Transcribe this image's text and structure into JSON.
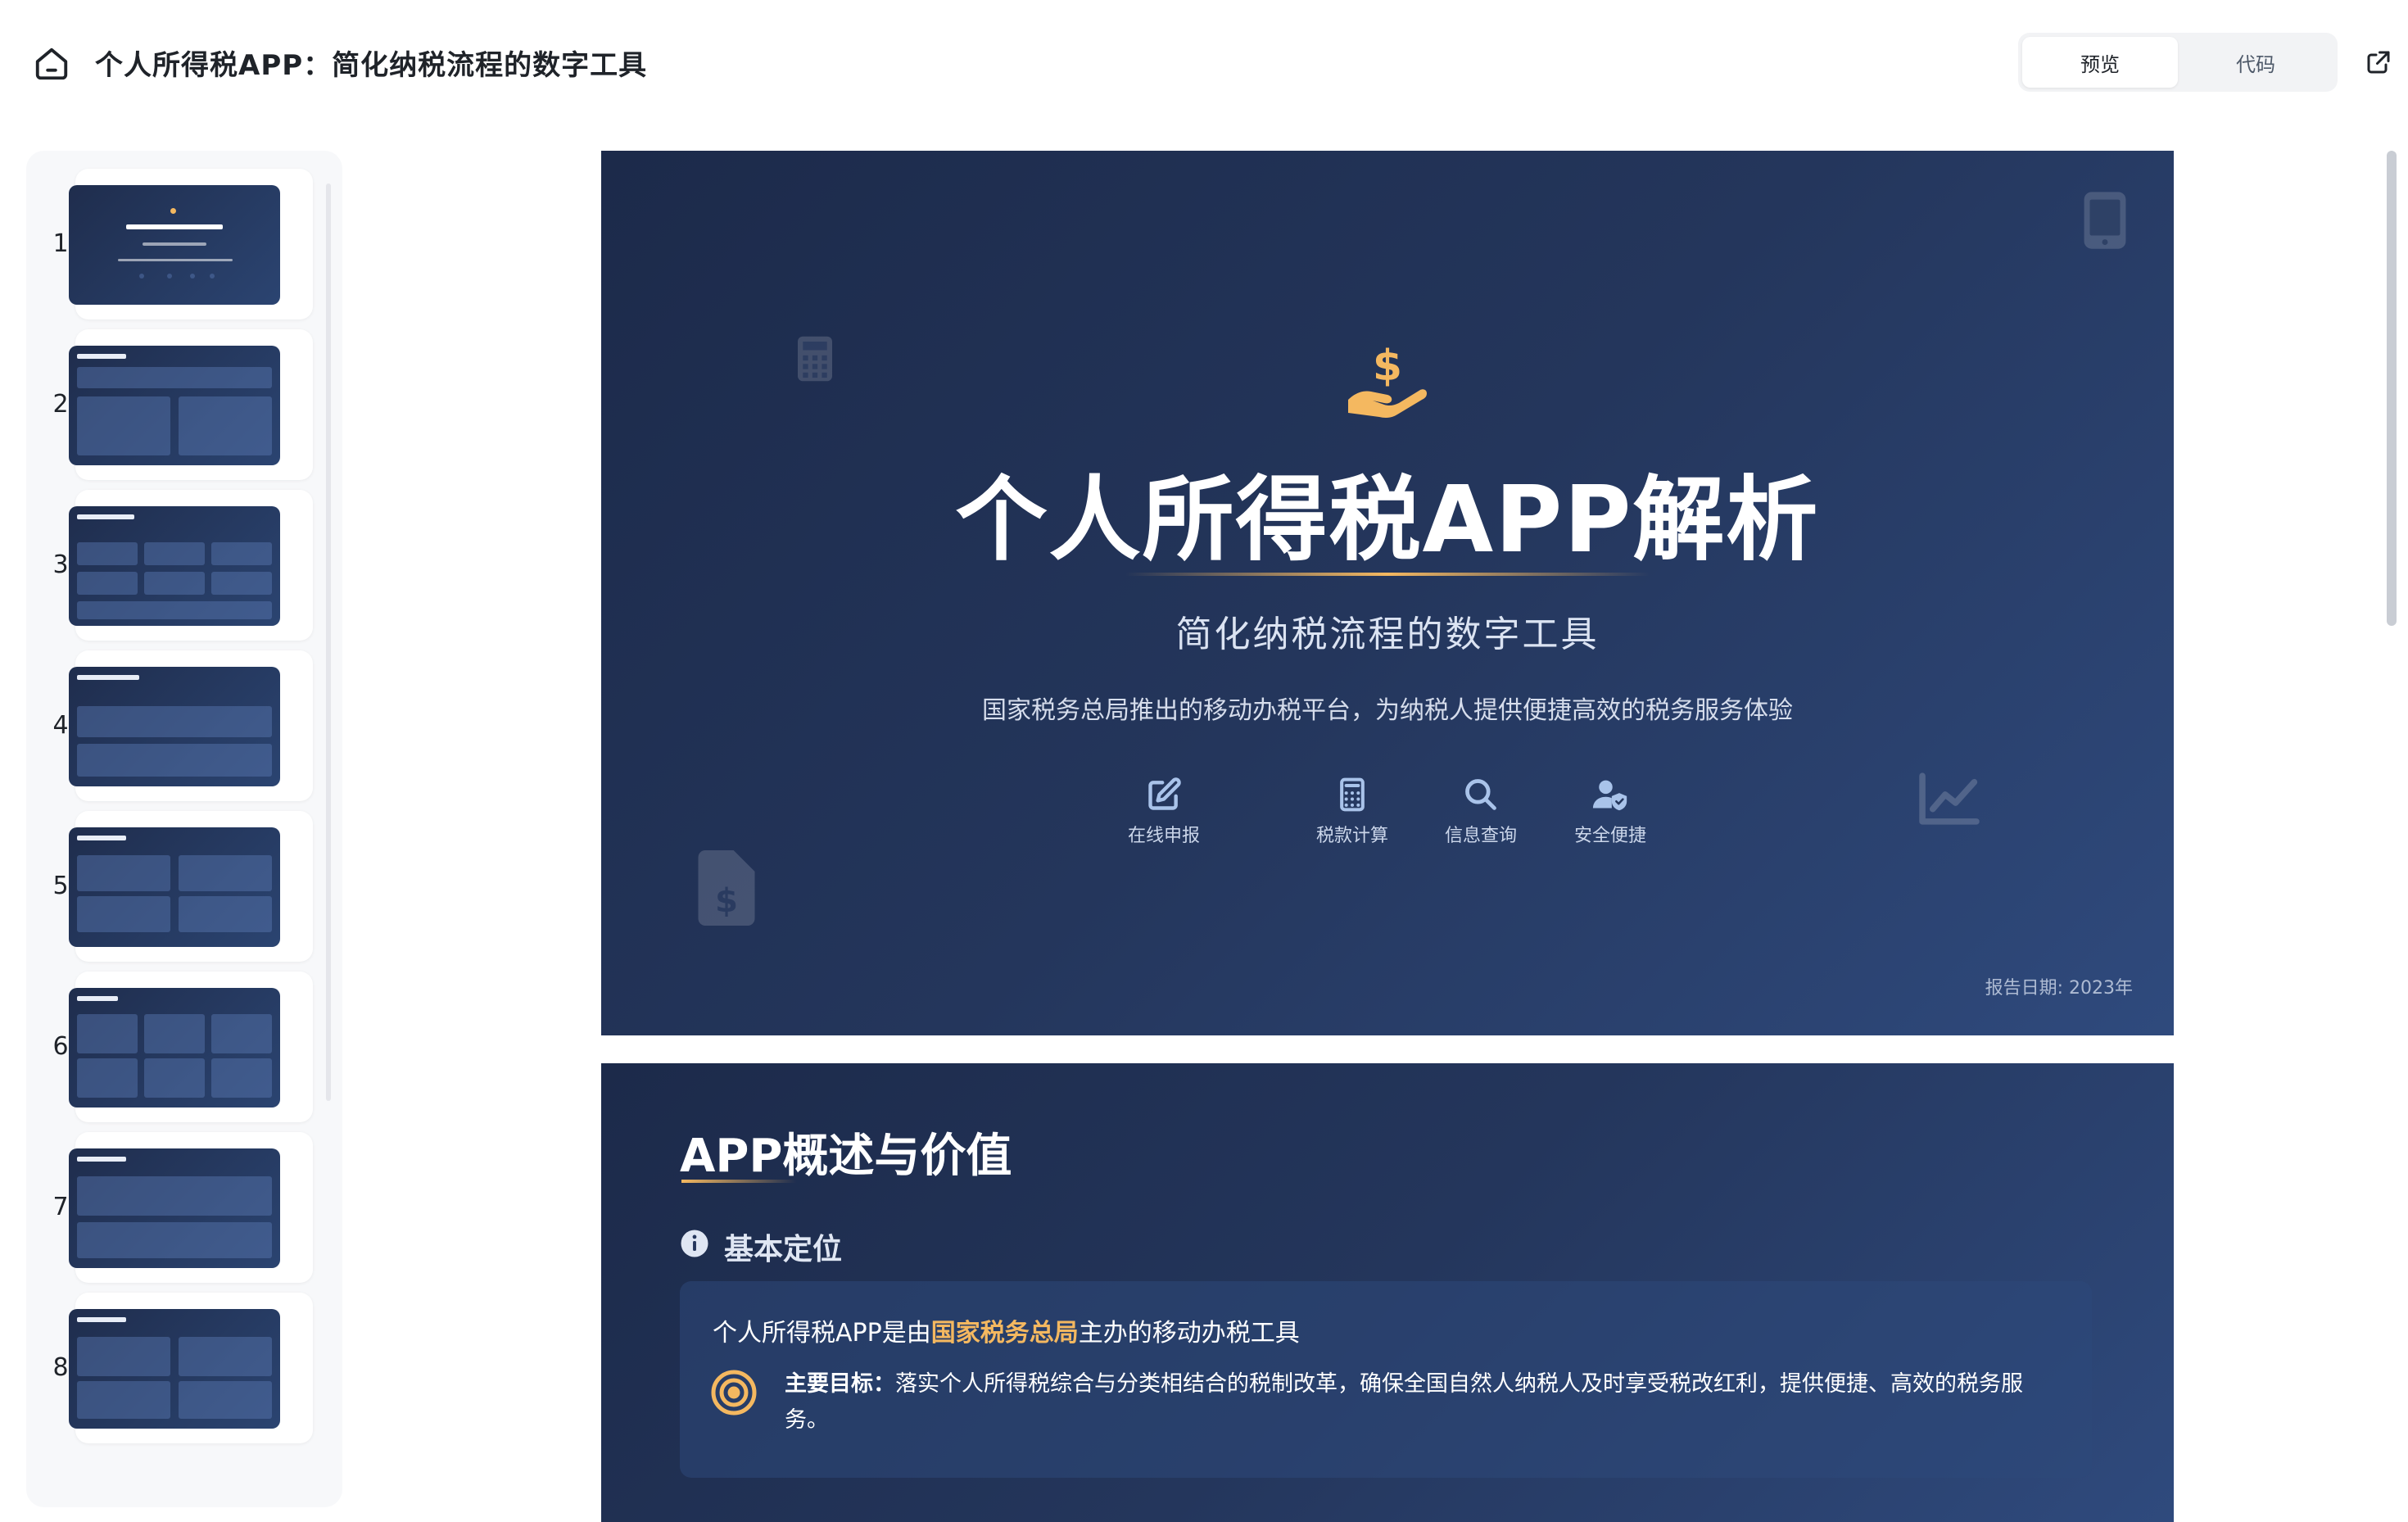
{
  "header": {
    "title": "个人所得税APP：简化纳税流程的数字工具",
    "tabs": [
      {
        "label": "预览",
        "active": true
      },
      {
        "label": "代码",
        "active": false
      }
    ]
  },
  "sidebar": {
    "thumbnails": [
      {
        "number": "1"
      },
      {
        "number": "2"
      },
      {
        "number": "3"
      },
      {
        "number": "4"
      },
      {
        "number": "5"
      },
      {
        "number": "6"
      },
      {
        "number": "7"
      },
      {
        "number": "8"
      }
    ]
  },
  "slide1": {
    "title": "个人所得税APP解析",
    "subtitle": "简化纳税流程的数字工具",
    "description": "国家税务总局推出的移动办税平台，为纳税人提供便捷高效的税务服务体验",
    "features": [
      {
        "label": "在线申报",
        "icon": "edit-icon"
      },
      {
        "label": "税款计算",
        "icon": "calculator-icon"
      },
      {
        "label": "信息查询",
        "icon": "search-icon"
      },
      {
        "label": "安全便捷",
        "icon": "user-shield-icon"
      }
    ],
    "date": "报告日期: 2023年"
  },
  "slide2": {
    "title": "APP概述与价值",
    "section": "基本定位",
    "line1_prefix": "个人所得税APP是由",
    "line1_highlight": "国家税务总局",
    "line1_suffix": "主办的移动办税工具",
    "goal_label": "主要目标：",
    "goal_text": "落实个人所得税综合与分类相结合的税制改革，确保全国自然人纳税人及时享受税改红利，提供便捷、高效的税务服务。"
  },
  "colors": {
    "slide_bg_start": "#1c2a4a",
    "slide_bg_end": "#2f4a7d",
    "accent": "#f4b860"
  }
}
